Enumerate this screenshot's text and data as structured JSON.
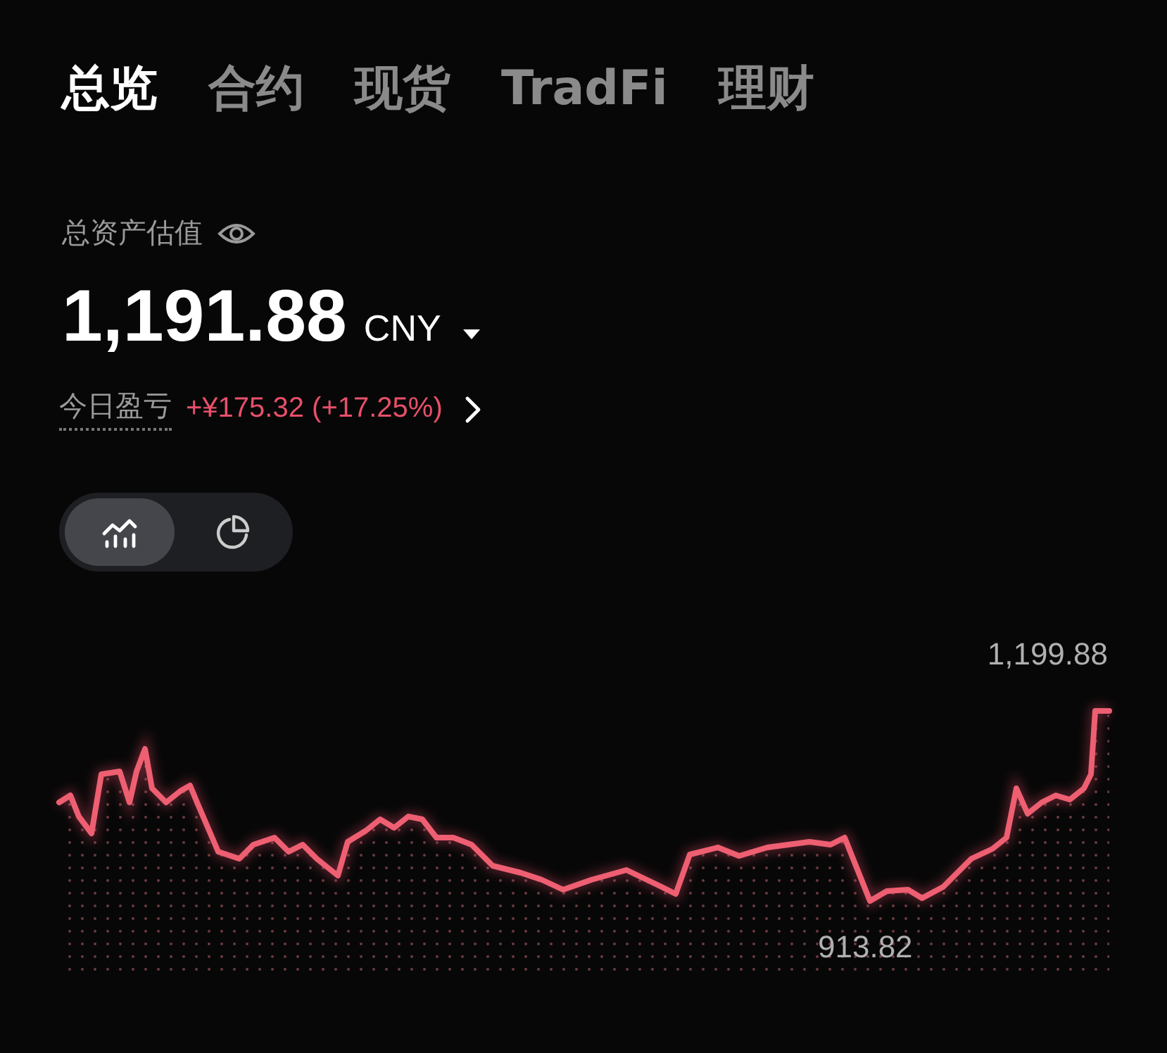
{
  "tabs": [
    {
      "label": "总览",
      "selected": true
    },
    {
      "label": "合约",
      "selected": false
    },
    {
      "label": "现货",
      "selected": false
    },
    {
      "label": "TradFi",
      "selected": false
    },
    {
      "label": "理财",
      "selected": false
    }
  ],
  "asset": {
    "label": "总资产估值",
    "amount": "1,191.88",
    "currency": "CNY"
  },
  "pnl": {
    "label": "今日盈亏",
    "value": "+¥175.32 (+17.25%)"
  },
  "view_toggle": [
    {
      "kind": "line",
      "selected": true
    },
    {
      "kind": "pie",
      "selected": false
    }
  ],
  "chart": {
    "max_label": "1,199.88",
    "min_label": "913.82"
  }
}
